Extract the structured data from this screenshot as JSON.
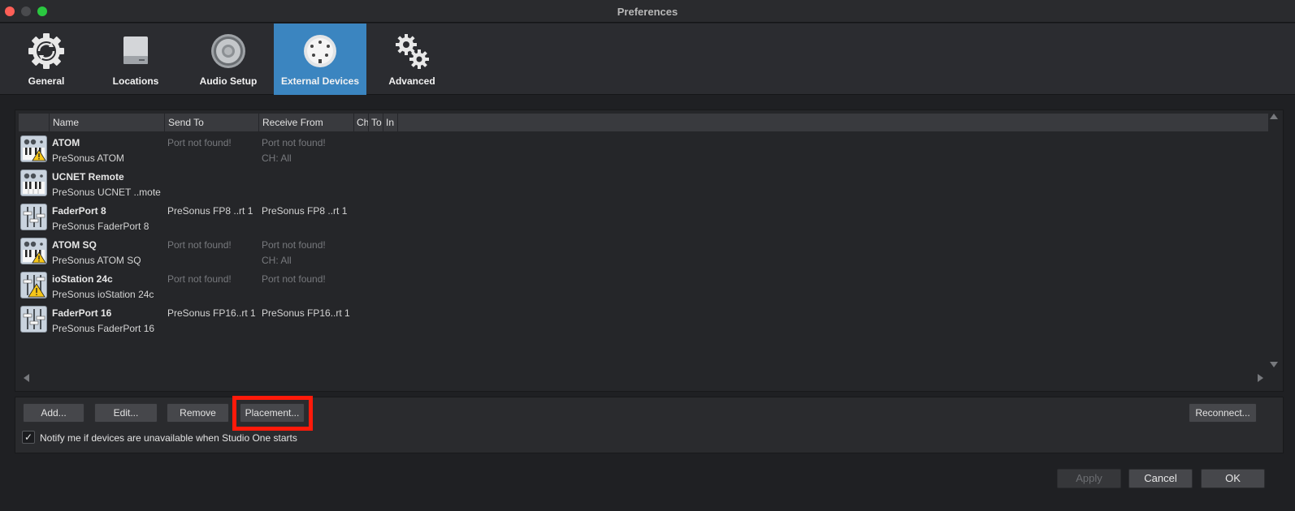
{
  "window": {
    "title": "Preferences"
  },
  "tabs": [
    {
      "label": "General",
      "icon": "gear-sync-icon"
    },
    {
      "label": "Locations",
      "icon": "drive-icon"
    },
    {
      "label": "Audio Setup",
      "icon": "speaker-icon"
    },
    {
      "label": "External Devices",
      "icon": "midi-port-icon",
      "active": true
    },
    {
      "label": "Advanced",
      "icon": "gears-icon"
    }
  ],
  "table": {
    "columns": [
      "Name",
      "Send To",
      "Receive From",
      "Ch",
      "To",
      "In"
    ],
    "rows": [
      {
        "name": "ATOM",
        "model": "PreSonus ATOM",
        "send_to": "Port not found!",
        "receive_from": "Port not found!",
        "receive_extra": "CH: All",
        "icon": "keyboard-warning-icon"
      },
      {
        "name": "UCNET Remote",
        "model": "PreSonus UCNET ..mote",
        "send_to": "",
        "receive_from": "",
        "receive_extra": "",
        "icon": "keyboard-icon"
      },
      {
        "name": "FaderPort 8",
        "model": "PreSonus FaderPort 8",
        "send_to": "PreSonus FP8 ..rt 1",
        "receive_from": "PreSonus FP8 ..rt 1",
        "receive_extra": "",
        "icon": "fader-icon"
      },
      {
        "name": "ATOM SQ",
        "model": "PreSonus ATOM SQ",
        "send_to": "Port not found!",
        "receive_from": "Port not found!",
        "receive_extra": "CH: All",
        "icon": "keyboard-warning-icon"
      },
      {
        "name": "ioStation 24c",
        "model": "PreSonus ioStation 24c",
        "send_to": "Port not found!",
        "receive_from": "Port not found!",
        "receive_extra": "",
        "icon": "fader-warning-icon"
      },
      {
        "name": "FaderPort 16",
        "model": "PreSonus FaderPort 16",
        "send_to": "PreSonus FP16..rt 1",
        "receive_from": "PreSonus FP16..rt 1",
        "receive_extra": "",
        "icon": "fader-icon"
      }
    ]
  },
  "buttons": {
    "add": "Add...",
    "edit": "Edit...",
    "remove": "Remove",
    "placement": "Placement...",
    "reconnect": "Reconnect...",
    "apply": "Apply",
    "cancel": "Cancel",
    "ok": "OK"
  },
  "notify": {
    "label": "Notify me if devices are unavailable when Studio One starts",
    "checked": true,
    "check_glyph": "✓"
  },
  "colors": {
    "accent": "#3b85c0",
    "highlight": "#ff1a0a",
    "warning": "#f5c518"
  }
}
